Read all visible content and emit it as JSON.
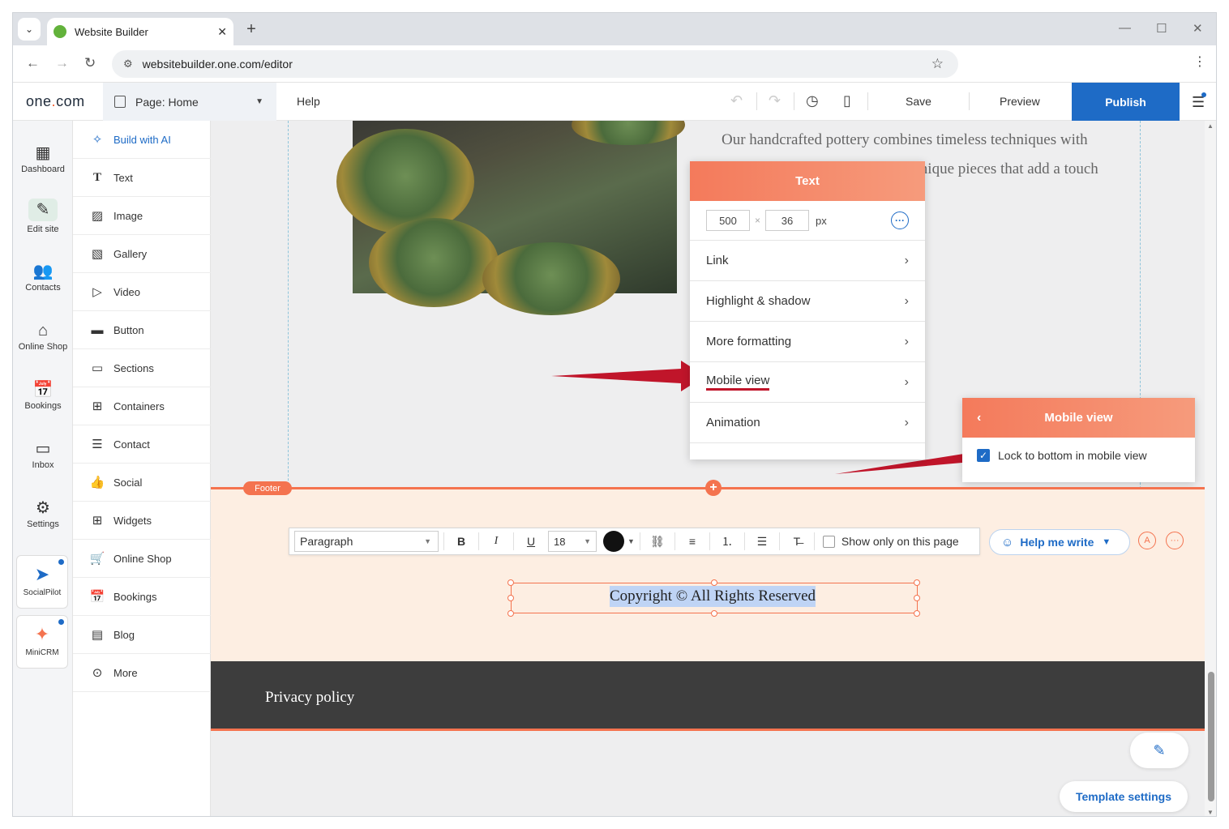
{
  "browser": {
    "tab_title": "Website Builder",
    "url": "websitebuilder.one.com/editor",
    "new_tab": "+",
    "close": "✕"
  },
  "header": {
    "logo_pre": "one",
    "logo_dot": ".",
    "logo_post": "com",
    "page_prefix": "Page: ",
    "page_name": "Home",
    "help": "Help",
    "save": "Save",
    "preview": "Preview",
    "publish": "Publish"
  },
  "rail": [
    {
      "label": "Dashboard",
      "icon": "dashboard-icon"
    },
    {
      "label": "Edit site",
      "icon": "edit-site-icon"
    },
    {
      "label": "Contacts",
      "icon": "contacts-icon"
    },
    {
      "label": "Online Shop",
      "icon": "shop-icon"
    },
    {
      "label": "Bookings",
      "icon": "bookings-icon"
    },
    {
      "label": "Inbox",
      "icon": "inbox-icon"
    },
    {
      "label": "Settings",
      "icon": "gear-icon"
    }
  ],
  "rail_cards": [
    {
      "label": "SocialPilot"
    },
    {
      "label": "MiniCRM"
    }
  ],
  "panel": [
    {
      "label": "Build with AI"
    },
    {
      "label": "Text"
    },
    {
      "label": "Image"
    },
    {
      "label": "Gallery"
    },
    {
      "label": "Video"
    },
    {
      "label": "Button"
    },
    {
      "label": "Sections"
    },
    {
      "label": "Containers"
    },
    {
      "label": "Contact"
    },
    {
      "label": "Social"
    },
    {
      "label": "Widgets"
    },
    {
      "label": "Online Shop"
    },
    {
      "label": "Bookings"
    },
    {
      "label": "Blog"
    },
    {
      "label": "More"
    }
  ],
  "content": {
    "paragraph": "Our handcrafted pottery combines timeless techniques with contemporary design, creating unique pieces that add a touch of artistry to any space."
  },
  "text_popup": {
    "title": "Text",
    "width": "500",
    "height": "36",
    "unit": "px",
    "times": "×",
    "rows": [
      "Link",
      "Highlight & shadow",
      "More formatting",
      "Mobile view",
      "Animation"
    ]
  },
  "mobile_popup": {
    "title": "Mobile view",
    "option": "Lock to bottom in mobile view",
    "checked": true
  },
  "footer": {
    "badge": "Footer",
    "format": "Paragraph",
    "font_size": "18",
    "show_only": "Show only on this page",
    "help_write": "Help me write",
    "copyright": "Copyright © All Rights Reserved",
    "privacy": "Privacy policy",
    "template_settings": "Template settings"
  },
  "colors": {
    "accent": "#f4734f",
    "publish": "#1e6bc6",
    "footer_bg": "#fdeee2",
    "dark_bg": "#3d3d3d",
    "arrow": "#c0152a"
  }
}
